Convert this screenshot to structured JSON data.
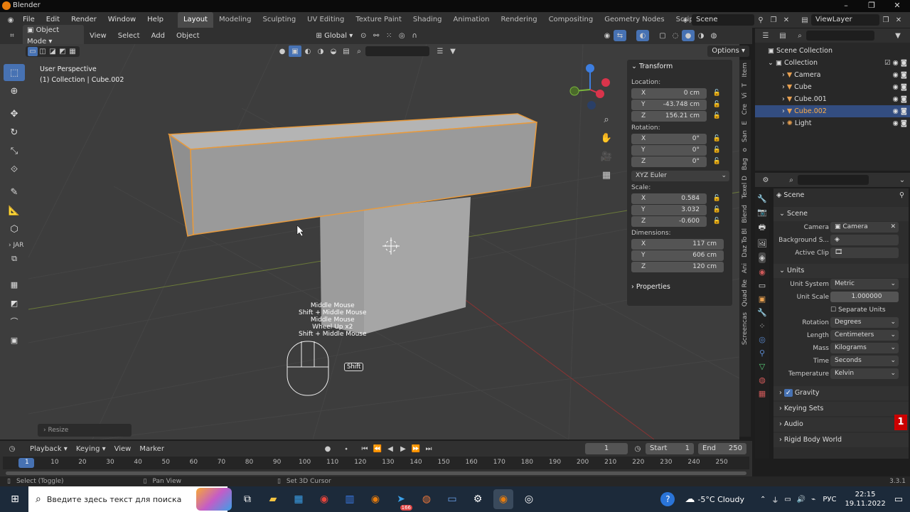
{
  "title_bar": {
    "app_title": "Blender",
    "min": "–",
    "max": "❐",
    "close": "✕"
  },
  "menu": {
    "items": [
      "File",
      "Edit",
      "Render",
      "Window",
      "Help"
    ]
  },
  "workspaces": [
    "Layout",
    "Modeling",
    "Sculpting",
    "UV Editing",
    "Texture Paint",
    "Shading",
    "Animation",
    "Rendering",
    "Compositing",
    "Geometry Nodes",
    "Scripting"
  ],
  "scene_selector": {
    "label": "Scene",
    "view_layer": "ViewLayer"
  },
  "viewport_header": {
    "mode": "Object Mode",
    "menus": [
      "View",
      "Select",
      "Add",
      "Object"
    ],
    "orientation": "Global",
    "options": "Options"
  },
  "viewport": {
    "perspective": "User Perspective",
    "collection_info": "(1) Collection | Cube.002",
    "key_hints": [
      "Middle Mouse",
      "Shift + Middle Mouse",
      "Middle Mouse",
      "Wheel Up x2",
      "Shift + Middle Mouse"
    ],
    "shift_badge": "Shift",
    "resize_label": "Resize",
    "toolbar_section": "JAR"
  },
  "transform": {
    "title": "Transform",
    "location_label": "Location:",
    "location": [
      {
        "axis": "X",
        "value": "0 cm"
      },
      {
        "axis": "Y",
        "value": "-43.748 cm"
      },
      {
        "axis": "Z",
        "value": "156.21 cm"
      }
    ],
    "rotation_label": "Rotation:",
    "rotation": [
      {
        "axis": "X",
        "value": "0°"
      },
      {
        "axis": "Y",
        "value": "0°"
      },
      {
        "axis": "Z",
        "value": "0°"
      }
    ],
    "rotation_mode": "XYZ Euler",
    "scale_label": "Scale:",
    "scale": [
      {
        "axis": "X",
        "value": "0.584"
      },
      {
        "axis": "Y",
        "value": "3.032"
      },
      {
        "axis": "Z",
        "value": "-0.600"
      }
    ],
    "dimensions_label": "Dimensions:",
    "dimensions": [
      {
        "axis": "X",
        "value": "117 cm"
      },
      {
        "axis": "Y",
        "value": "606 cm"
      },
      {
        "axis": "Z",
        "value": "120 cm"
      }
    ],
    "properties": "Properties"
  },
  "side_tabs": [
    "Item",
    "T",
    "Vi",
    "Cre",
    "E",
    "San",
    "o",
    "Bag",
    "Texel D",
    "Blend",
    "Daz To Bl",
    "Ani",
    "Quad Re",
    "Screencas"
  ],
  "outliner": {
    "root": "Scene Collection",
    "collection": "Collection",
    "items": [
      {
        "name": "Camera",
        "selected": false
      },
      {
        "name": "Cube",
        "selected": false
      },
      {
        "name": "Cube.001",
        "selected": false
      },
      {
        "name": "Cube.002",
        "selected": true
      },
      {
        "name": "Light",
        "selected": false
      }
    ]
  },
  "properties_panel": {
    "header": "Scene",
    "scene_section": "Scene",
    "camera_label": "Camera",
    "camera_value": "Camera",
    "background_label": "Background S...",
    "active_clip_label": "Active Clip",
    "units_section": "Units",
    "unit_system_label": "Unit System",
    "unit_system": "Metric",
    "unit_scale_label": "Unit Scale",
    "unit_scale": "1.000000",
    "separate_units": "Separate Units",
    "rotation_label": "Rotation",
    "rotation": "Degrees",
    "length_label": "Length",
    "length": "Centimeters",
    "mass_label": "Mass",
    "mass": "Kilograms",
    "time_label": "Time",
    "time": "Seconds",
    "temperature_label": "Temperature",
    "temperature": "Kelvin",
    "gravity": "Gravity",
    "keying_sets": "Keying Sets",
    "audio": "Audio",
    "rigid_body_world": "Rigid Body World"
  },
  "timeline": {
    "menus": [
      "Playback",
      "Keying",
      "View",
      "Marker"
    ],
    "current_frame": "1",
    "start_label": "Start",
    "start": "1",
    "end_label": "End",
    "end": "250",
    "ticks": [
      "1",
      "10",
      "20",
      "30",
      "40",
      "50",
      "60",
      "70",
      "80",
      "90",
      "100",
      "110",
      "120",
      "130",
      "140",
      "150",
      "160",
      "170",
      "180",
      "190",
      "200",
      "210",
      "220",
      "230",
      "240",
      "250"
    ]
  },
  "status_bar": {
    "select": "Select (Toggle)",
    "pan": "Pan View",
    "cursor": "Set 3D Cursor",
    "version": "3.3.1"
  },
  "taskbar": {
    "search_placeholder": "Введите здесь текст для поиска",
    "weather": "-5°C Cloudy",
    "lang": "РУС",
    "time": "22:15",
    "date": "19.11.2022",
    "telegram_badge": "166",
    "notify": "1"
  },
  "colors": {
    "accent": "#4772b3",
    "selection_outline": "#e89a3c",
    "taskbar": "#1c2a3a"
  }
}
